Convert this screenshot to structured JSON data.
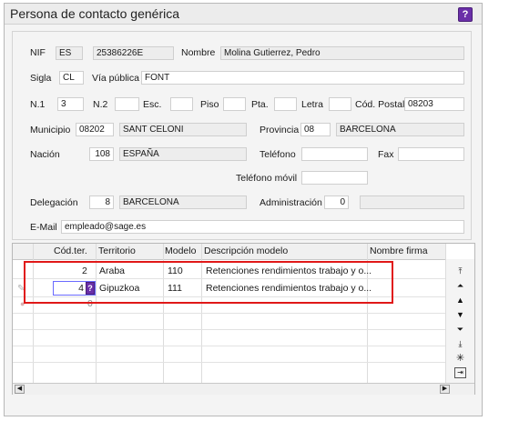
{
  "window": {
    "title": "Persona de contacto genérica",
    "help_label": "?"
  },
  "form": {
    "nif_label": "NIF",
    "nif_country": "ES",
    "nif_value": "25386226E",
    "nombre_label": "Nombre",
    "nombre_value": "Molina Gutierrez, Pedro",
    "sigla_label": "Sigla",
    "sigla_value": "CL",
    "via_label": "Vía pública",
    "via_value": "FONT",
    "n1_label": "N.1",
    "n1_value": "3",
    "n2_label": "N.2",
    "n2_value": "",
    "esc_label": "Esc.",
    "esc_value": "",
    "piso_label": "Piso",
    "piso_value": "",
    "pta_label": "Pta.",
    "pta_value": "",
    "letra_label": "Letra",
    "letra_value": "",
    "cp_label": "Cód. Postal",
    "cp_value": "08203",
    "municipio_label": "Municipio",
    "municipio_code": "08202",
    "municipio_name": "SANT CELONI",
    "provincia_label": "Provincia",
    "provincia_code": "08",
    "provincia_name": "BARCELONA",
    "nacion_label": "Nación",
    "nacion_code": "108",
    "nacion_name": "ESPAÑA",
    "telefono_label": "Teléfono",
    "telefono_value": "",
    "fax_label": "Fax",
    "fax_value": "",
    "movil_label": "Teléfono móvil",
    "movil_value": "",
    "delegacion_label": "Delegación",
    "delegacion_code": "8",
    "delegacion_name": "BARCELONA",
    "administracion_label": "Administración",
    "administracion_code": "0",
    "administracion_name": "",
    "email_label": "E-Mail",
    "email_value": "empleado@sage.es"
  },
  "grid": {
    "columns": [
      "Cód.ter.",
      "Territorio",
      "Modelo",
      "Descripción modelo",
      "Nombre firma"
    ],
    "rows": [
      {
        "cod": "2",
        "territorio": "Araba",
        "modelo": "110",
        "descripcion": "Retenciones rendimientos trabajo y o..."
      },
      {
        "cod": "4",
        "territorio": "Gipuzkoa",
        "modelo": "111",
        "descripcion": "Retenciones rendimientos trabajo y o..."
      },
      {
        "cod": "0",
        "territorio": "",
        "modelo": "",
        "descripcion": ""
      }
    ],
    "lookup_label": "?",
    "nav_icons": [
      "first-icon",
      "prev-page-icon",
      "prev-icon",
      "next-icon",
      "next-page-icon",
      "last-icon",
      "new-row-icon",
      "export-icon"
    ]
  }
}
